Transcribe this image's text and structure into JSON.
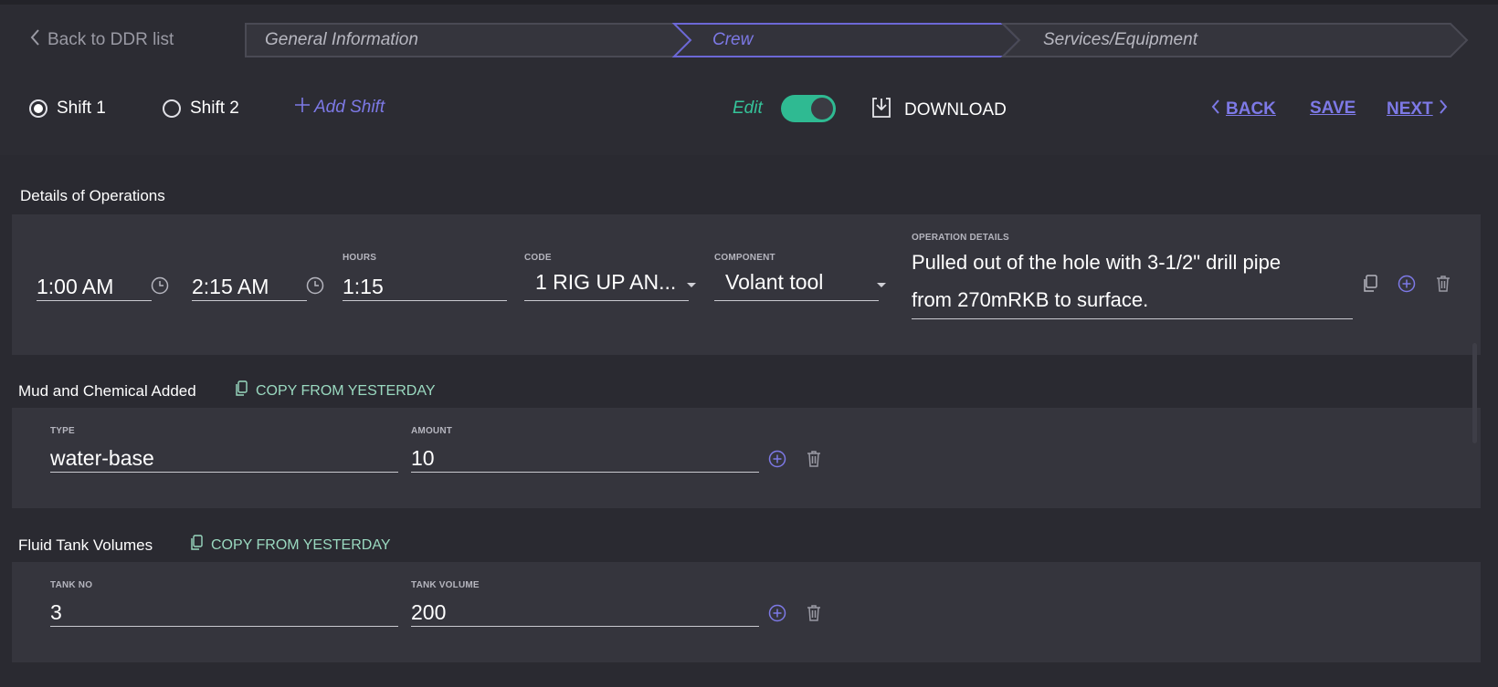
{
  "nav": {
    "back_label": "Back to DDR list",
    "steps": [
      "General Information",
      "Crew",
      "Services/Equipment"
    ],
    "active_step": "Crew"
  },
  "toolbar": {
    "shift1": "Shift 1",
    "shift2": "Shift 2",
    "add_shift": "Add Shift",
    "edit_label": "Edit",
    "edit_on": true,
    "download": "DOWNLOAD",
    "back": "BACK",
    "save": "SAVE",
    "next": "NEXT"
  },
  "operations": {
    "title": "Details of Operations",
    "start_time": "1:00 AM",
    "end_time": "2:15 AM",
    "hours_label": "HOURS",
    "hours": "1:15",
    "code_label": "CODE",
    "code": "1 RIG UP AN...",
    "component_label": "COMPONENT",
    "component": "Volant tool",
    "details_label": "OPERATION DETAILS",
    "details_line1": "Pulled out of the hole with 3-1/2\" drill pipe",
    "details_line2": "from 270mRKB to surface."
  },
  "mud": {
    "title": "Mud and Chemical Added",
    "copy_label": "COPY FROM YESTERDAY",
    "type_label": "TYPE",
    "type": "water-base",
    "amount_label": "AMOUNT",
    "amount": "10"
  },
  "tanks": {
    "title": "Fluid Tank Volumes",
    "copy_label": "COPY FROM YESTERDAY",
    "tank_no_label": "TANK NO",
    "tank_no": "3",
    "volume_label": "TANK VOLUME",
    "volume": "200"
  },
  "colors": {
    "accent": "#7d79e6",
    "toggle": "#2fba92",
    "copy": "#9ad9c0",
    "background": "#2a2a31",
    "panel": "#35353d"
  }
}
